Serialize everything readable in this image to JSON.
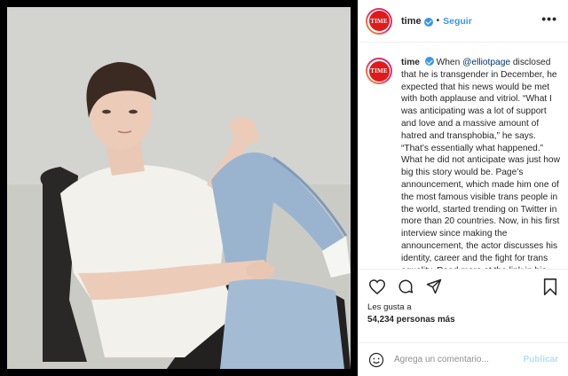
{
  "account": {
    "username": "time",
    "avatar_text": "TIME",
    "avatar_color": "#e01a1a",
    "verified": true
  },
  "header": {
    "dot": "•",
    "follow_label": "Seguir",
    "more_label": "•••"
  },
  "caption": {
    "username": "time",
    "intro": "When ",
    "mention": "@elliotpage",
    "body": " disclosed that he is transgender in December, he expected that his news would be met with both applause and vitriol. “What I was anticipating was a lot of support and love and a massive amount of hatred and transphobia,” he says. “That’s essentially what happened.” What he did not anticipate was just how big this story would be. Page’s announcement, which made him one of the most famous visible trans people in the world, started trending on Twitter in more than 20 countries. Now, in his first interview since making the announcement, the actor discusses his identity, career and the fight for trans equality. Read more at the link in bio. Photograph by @wynnemyriskcoll for TIME"
  },
  "actions": {
    "like_icon": "heart-icon",
    "comment_icon": "comment-icon",
    "share_icon": "share-icon",
    "save_icon": "bookmark-icon"
  },
  "likes": {
    "label": "Les gusta a",
    "count": "54,234 personas más"
  },
  "comment": {
    "placeholder": "Agrega un comentario...",
    "post_label": "Publicar"
  },
  "colors": {
    "link_blue": "#3897f0",
    "mention_blue": "#00376b",
    "post_disabled": "#b2dffc"
  }
}
